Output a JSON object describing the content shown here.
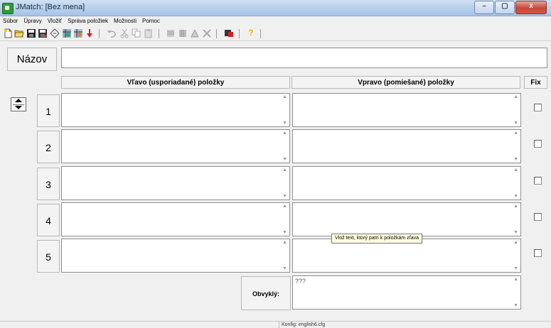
{
  "window": {
    "title": "JMatch: [Bez mena]",
    "minimize_glyph": "–",
    "maximize_glyph": "▢",
    "close_glyph": "x"
  },
  "menu": [
    "Súbor",
    "Úpravy",
    "Vložiť",
    "Správa položiek",
    "Možnosti",
    "Pomoc"
  ],
  "toolbar": {
    "icons": [
      "new-file-icon",
      "open-folder-icon",
      "save-icon",
      "save-as-icon",
      "clear-icon",
      "web-page-icon",
      "web-page-alt-icon",
      "insert-icon",
      "undo-icon",
      "cut-icon",
      "copy-icon",
      "paste-icon",
      "format-icon",
      "format2-icon",
      "format3-icon",
      "format4-icon",
      "export-icon",
      "help-icon"
    ],
    "help_glyph": "?"
  },
  "title_label": "Názov",
  "title_value": "",
  "columns": {
    "left": "Vľavo (usporiadané) položky",
    "right": "Vpravo (pomiešané) položky",
    "fix": "Fix"
  },
  "rows": [
    {
      "num": "1",
      "left": "",
      "right": "",
      "fix": false
    },
    {
      "num": "2",
      "left": "",
      "right": "",
      "fix": false
    },
    {
      "num": "3",
      "left": "",
      "right": "",
      "fix": false
    },
    {
      "num": "4",
      "left": "",
      "right": "",
      "fix": false
    },
    {
      "num": "5",
      "left": "",
      "right": "",
      "fix": false
    }
  ],
  "default": {
    "label": "Obvyklý:",
    "value": "???"
  },
  "tooltip": "Vlož text, ktorý patrí k položkám zľava",
  "status": "Konfig: english6.cfg",
  "colors": {
    "titlebar": "#b9d1ec",
    "close_button": "#c7473a",
    "help_icon": "#e8b800",
    "red_arrow": "#d02020"
  }
}
